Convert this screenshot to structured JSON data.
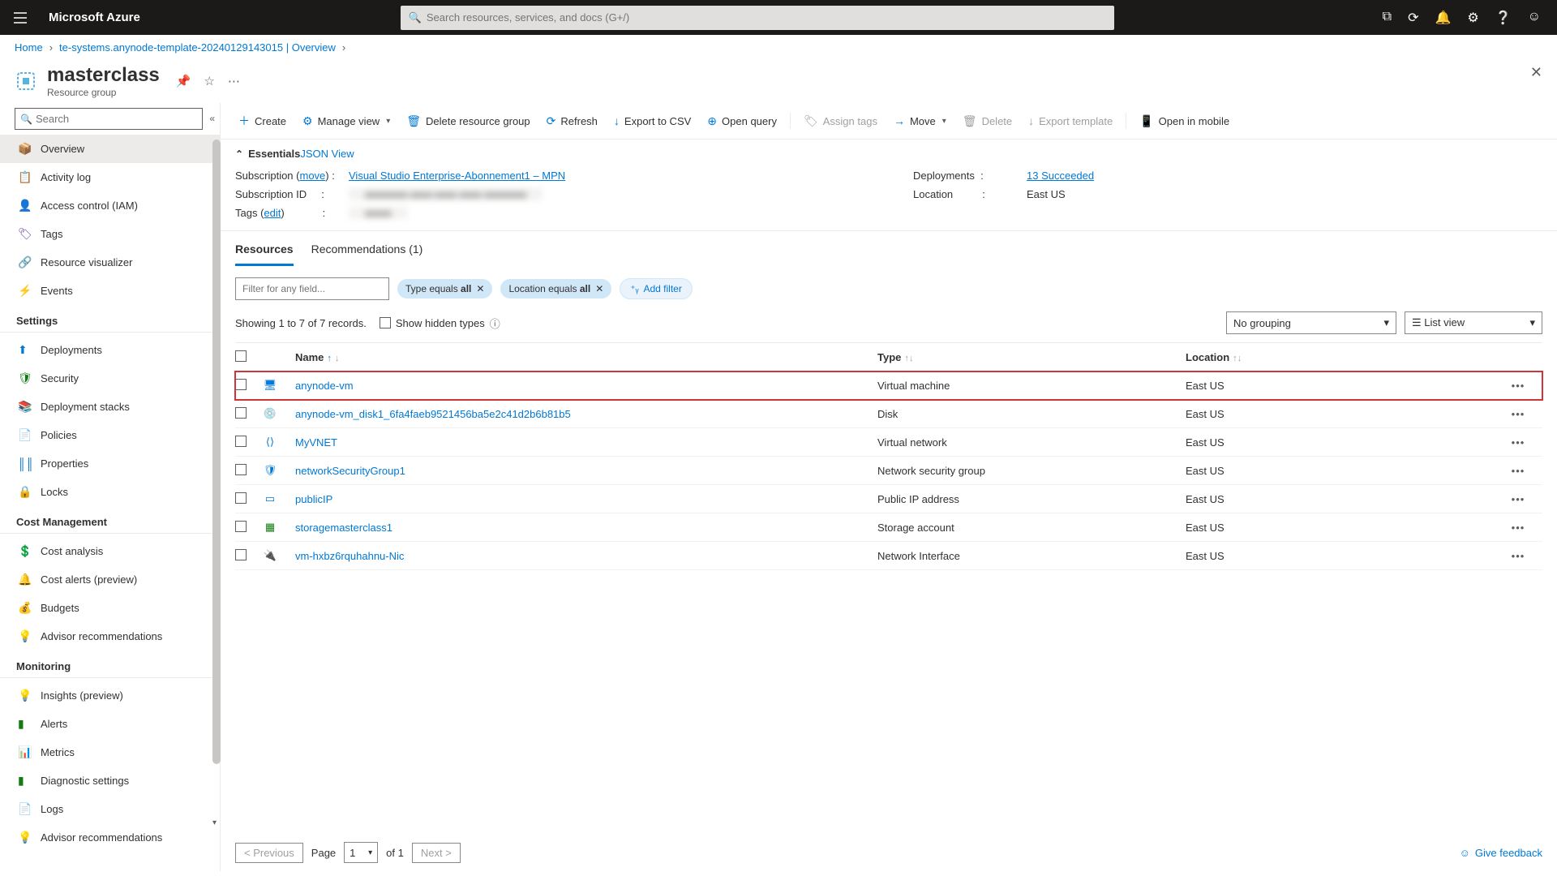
{
  "header": {
    "brand": "Microsoft Azure",
    "search_placeholder": "Search resources, services, and docs (G+/)"
  },
  "breadcrumb": {
    "home": "Home",
    "path": "te-systems.anynode-template-20240129143015 | Overview"
  },
  "page": {
    "title": "masterclass",
    "subtitle": "Resource group"
  },
  "side_search_placeholder": "Search",
  "sidebar": {
    "groups": [
      {
        "title": "",
        "items": [
          {
            "label": "Overview",
            "icon": "📦",
            "color": "#0078d4",
            "active": true
          },
          {
            "label": "Activity log",
            "icon": "📋",
            "color": "#0078d4"
          },
          {
            "label": "Access control (IAM)",
            "icon": "👤",
            "color": "#0078d4"
          },
          {
            "label": "Tags",
            "icon": "🏷",
            "color": "#6b3fa0"
          },
          {
            "label": "Resource visualizer",
            "icon": "🔗",
            "color": "#0078d4"
          },
          {
            "label": "Events",
            "icon": "⚡",
            "color": "#ffb900"
          }
        ]
      },
      {
        "title": "Settings",
        "items": [
          {
            "label": "Deployments",
            "icon": "⬆",
            "color": "#0078d4"
          },
          {
            "label": "Security",
            "icon": "🛡",
            "color": "#107c10"
          },
          {
            "label": "Deployment stacks",
            "icon": "📚",
            "color": "#0078d4"
          },
          {
            "label": "Policies",
            "icon": "📄",
            "color": "#0078d4"
          },
          {
            "label": "Properties",
            "icon": "║║",
            "color": "#0078d4"
          },
          {
            "label": "Locks",
            "icon": "🔒",
            "color": "#0078d4"
          }
        ]
      },
      {
        "title": "Cost Management",
        "items": [
          {
            "label": "Cost analysis",
            "icon": "💲",
            "color": "#605e5c"
          },
          {
            "label": "Cost alerts (preview)",
            "icon": "🔔",
            "color": "#107c10"
          },
          {
            "label": "Budgets",
            "icon": "💰",
            "color": "#0078d4"
          },
          {
            "label": "Advisor recommendations",
            "icon": "💡",
            "color": "#0078d4"
          }
        ]
      },
      {
        "title": "Monitoring",
        "items": [
          {
            "label": "Insights (preview)",
            "icon": "💡",
            "color": "#6b3fa0"
          },
          {
            "label": "Alerts",
            "icon": "▮",
            "color": "#107c10"
          },
          {
            "label": "Metrics",
            "icon": "📊",
            "color": "#0078d4"
          },
          {
            "label": "Diagnostic settings",
            "icon": "▮",
            "color": "#107c10"
          },
          {
            "label": "Logs",
            "icon": "📄",
            "color": "#0078d4"
          },
          {
            "label": "Advisor recommendations",
            "icon": "💡",
            "color": "#0078d4"
          }
        ]
      }
    ]
  },
  "toolbar": {
    "create": "Create",
    "manage_view": "Manage view",
    "delete_rg": "Delete resource group",
    "refresh": "Refresh",
    "export_csv": "Export to CSV",
    "open_query": "Open query",
    "assign_tags": "Assign tags",
    "move": "Move",
    "delete": "Delete",
    "export_template": "Export template",
    "open_mobile": "Open in mobile"
  },
  "essentials": {
    "header": "Essentials",
    "json_view": "JSON View",
    "sub_label": "Subscription",
    "sub_move": "move",
    "sub_value": "Visual Studio Enterprise-Abonnement1 – MPN",
    "subid_label": "Subscription ID",
    "subid_value": "xxxxxxxx-xxxx-xxxx-xxxx-xxxxxxxx",
    "tags_label": "Tags",
    "tags_edit": "edit",
    "tags_value": "xxxxx",
    "dep_label": "Deployments",
    "dep_value": "13 Succeeded",
    "loc_label": "Location",
    "loc_value": "East US"
  },
  "tabs": {
    "resources": "Resources",
    "recommendations": "Recommendations (1)"
  },
  "filters": {
    "placeholder": "Filter for any field...",
    "type_pill_prefix": "Type equals ",
    "type_pill_value": "all",
    "loc_pill_prefix": "Location equals ",
    "loc_pill_value": "all",
    "add_filter": "Add filter"
  },
  "results": {
    "count": "Showing 1 to 7 of 7 records.",
    "show_hidden": "Show hidden types",
    "grouping": "No grouping",
    "view": "List view"
  },
  "table": {
    "col_name": "Name",
    "col_type": "Type",
    "col_location": "Location",
    "rows": [
      {
        "name": "anynode-vm",
        "icon": "🖥",
        "color": "#0078d4",
        "type": "Virtual machine",
        "location": "East US",
        "hl": true
      },
      {
        "name": "anynode-vm_disk1_6fa4faeb9521456ba5e2c41d2b6b81b5",
        "icon": "💿",
        "color": "#107c10",
        "type": "Disk",
        "location": "East US"
      },
      {
        "name": "MyVNET",
        "icon": "⟨⟩",
        "color": "#0078d4",
        "type": "Virtual network",
        "location": "East US"
      },
      {
        "name": "networkSecurityGroup1",
        "icon": "🛡",
        "color": "#0078d4",
        "type": "Network security group",
        "location": "East US"
      },
      {
        "name": "publicIP",
        "icon": "▭",
        "color": "#0078d4",
        "type": "Public IP address",
        "location": "East US"
      },
      {
        "name": "storagemasterclass1",
        "icon": "▦",
        "color": "#107c10",
        "type": "Storage account",
        "location": "East US"
      },
      {
        "name": "vm-hxbz6rquhahnu-Nic",
        "icon": "🔌",
        "color": "#107c10",
        "type": "Network Interface",
        "location": "East US"
      }
    ]
  },
  "pagination": {
    "prev": "< Previous",
    "page_label": "Page",
    "page_value": "1",
    "of": "of 1",
    "next": "Next >",
    "feedback": "Give feedback"
  }
}
